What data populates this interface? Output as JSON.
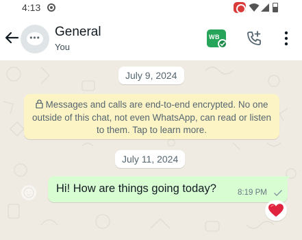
{
  "status_bar": {
    "time": "4:13"
  },
  "header": {
    "title": "General",
    "subtitle": "You",
    "business_badge_text": "WB"
  },
  "chat": {
    "date_1": "July 9, 2024",
    "encryption_notice": "Messages and calls are end-to-end encrypted. No one outside of this chat, not even WhatsApp, can read or listen to them. Tap to learn more.",
    "date_2": "July 11, 2024",
    "messages": [
      {
        "text": "Hi! How are things going today?",
        "time": "8:19 PM",
        "status": "read-check-icon",
        "reaction": "heart-icon"
      }
    ]
  },
  "icons": {
    "back": "back-arrow-icon",
    "avatar": "group-chat-icon",
    "call": "call-add-icon",
    "menu": "more-vert-icon"
  },
  "colors": {
    "chat_background": "#efeae2",
    "outgoing_bubble": "#d9fdd3",
    "notice_background": "#fdf4c5",
    "business_green": "#25a45a",
    "reaction_heart": "#e0243f"
  }
}
